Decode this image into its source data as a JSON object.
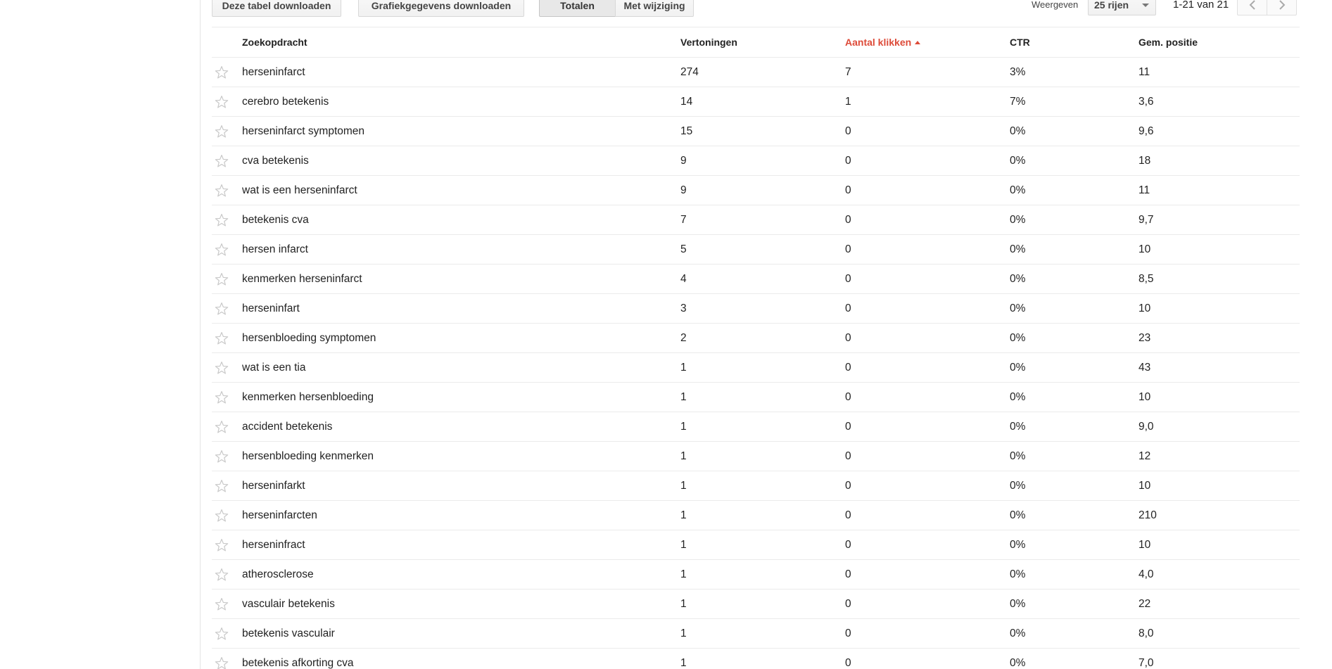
{
  "toolbar": {
    "download_table_label": "Deze tabel downloaden",
    "download_chart_label": "Grafiekgegevens downloaden",
    "totals_label": "Totalen",
    "change_label": "Met wijziging",
    "show_label": "Weergeven",
    "rows_value": "25 rijen",
    "pager_text": "1-21 van 21"
  },
  "icons": {
    "star": "star-outline-icon",
    "prev": "chevron-left-icon",
    "next": "chevron-right-icon",
    "caret": "caret-down-icon",
    "sort": "sort-ascending-icon"
  },
  "colors": {
    "sorted_header": "#dd4b39",
    "border": "#ebebeb"
  },
  "table": {
    "headers": {
      "query": "Zoekopdracht",
      "impressions": "Vertoningen",
      "clicks": "Aantal klikken",
      "ctr": "CTR",
      "position": "Gem. positie"
    },
    "rows": [
      {
        "query": "herseninfarct",
        "impressions": "274",
        "clicks": "7",
        "ctr": "3%",
        "position": "11"
      },
      {
        "query": "cerebro betekenis",
        "impressions": "14",
        "clicks": "1",
        "ctr": "7%",
        "position": "3,6"
      },
      {
        "query": "herseninfarct symptomen",
        "impressions": "15",
        "clicks": "0",
        "ctr": "0%",
        "position": "9,6"
      },
      {
        "query": "cva betekenis",
        "impressions": "9",
        "clicks": "0",
        "ctr": "0%",
        "position": "18"
      },
      {
        "query": "wat is een herseninfarct",
        "impressions": "9",
        "clicks": "0",
        "ctr": "0%",
        "position": "11"
      },
      {
        "query": "betekenis cva",
        "impressions": "7",
        "clicks": "0",
        "ctr": "0%",
        "position": "9,7"
      },
      {
        "query": "hersen infarct",
        "impressions": "5",
        "clicks": "0",
        "ctr": "0%",
        "position": "10"
      },
      {
        "query": "kenmerken herseninfarct",
        "impressions": "4",
        "clicks": "0",
        "ctr": "0%",
        "position": "8,5"
      },
      {
        "query": "herseninfart",
        "impressions": "3",
        "clicks": "0",
        "ctr": "0%",
        "position": "10"
      },
      {
        "query": "hersenbloeding symptomen",
        "impressions": "2",
        "clicks": "0",
        "ctr": "0%",
        "position": "23"
      },
      {
        "query": "wat is een tia",
        "impressions": "1",
        "clicks": "0",
        "ctr": "0%",
        "position": "43"
      },
      {
        "query": "kenmerken hersenbloeding",
        "impressions": "1",
        "clicks": "0",
        "ctr": "0%",
        "position": "10"
      },
      {
        "query": "accident betekenis",
        "impressions": "1",
        "clicks": "0",
        "ctr": "0%",
        "position": "9,0"
      },
      {
        "query": "hersenbloeding kenmerken",
        "impressions": "1",
        "clicks": "0",
        "ctr": "0%",
        "position": "12"
      },
      {
        "query": "herseninfarkt",
        "impressions": "1",
        "clicks": "0",
        "ctr": "0%",
        "position": "10"
      },
      {
        "query": "herseninfarcten",
        "impressions": "1",
        "clicks": "0",
        "ctr": "0%",
        "position": "210"
      },
      {
        "query": "herseninfract",
        "impressions": "1",
        "clicks": "0",
        "ctr": "0%",
        "position": "10"
      },
      {
        "query": "atherosclerose",
        "impressions": "1",
        "clicks": "0",
        "ctr": "0%",
        "position": "4,0"
      },
      {
        "query": "vasculair betekenis",
        "impressions": "1",
        "clicks": "0",
        "ctr": "0%",
        "position": "22"
      },
      {
        "query": "betekenis vasculair",
        "impressions": "1",
        "clicks": "0",
        "ctr": "0%",
        "position": "8,0"
      },
      {
        "query": "betekenis afkorting cva",
        "impressions": "1",
        "clicks": "0",
        "ctr": "0%",
        "position": "7,0"
      }
    ]
  }
}
